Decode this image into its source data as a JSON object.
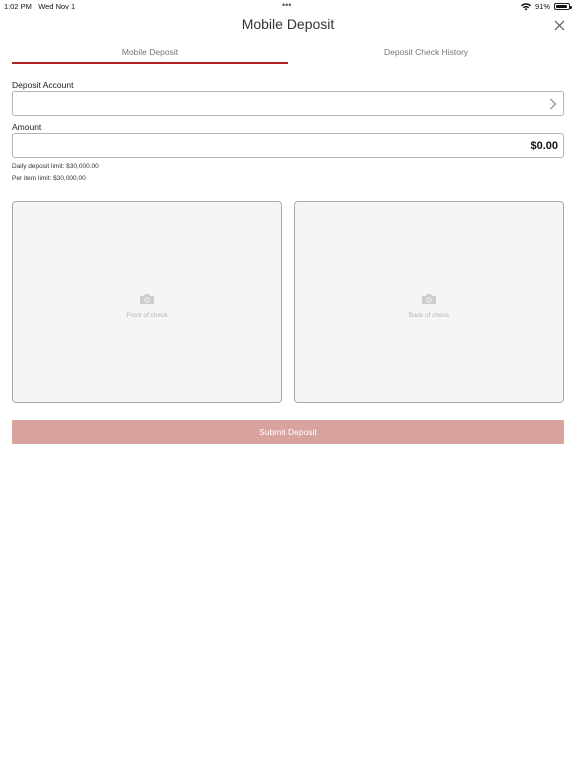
{
  "status_bar": {
    "time": "1:02 PM",
    "date": "Wed Nov 1",
    "battery": "91%",
    "battery_level": 0.91,
    "wifi_icon": "wifi-icon",
    "multitask_dots": "•••"
  },
  "header": {
    "title": "Mobile Deposit",
    "close_icon": "close-icon"
  },
  "tabs": [
    {
      "label": "Mobile Deposit",
      "selected": true
    },
    {
      "label": "Deposit Check History",
      "selected": false
    }
  ],
  "form": {
    "account_label": "Deposit Account",
    "account_value": "",
    "account_chevron_icon": "chevron-right-icon",
    "amount_label": "Amount",
    "amount_value": "$0.00",
    "daily_limit": "Daily deposit limit: $30,000.00",
    "item_limit": "Per item limit: $30,000.00"
  },
  "checks": {
    "front_caption": "Front of check",
    "back_caption": "Back of check",
    "icon": "camera-icon"
  },
  "submit_label": "Submit Deposit",
  "colors": {
    "accent": "#b22222",
    "submit_disabled": "#d8a39d",
    "check_bg": "#f5f5f5"
  }
}
